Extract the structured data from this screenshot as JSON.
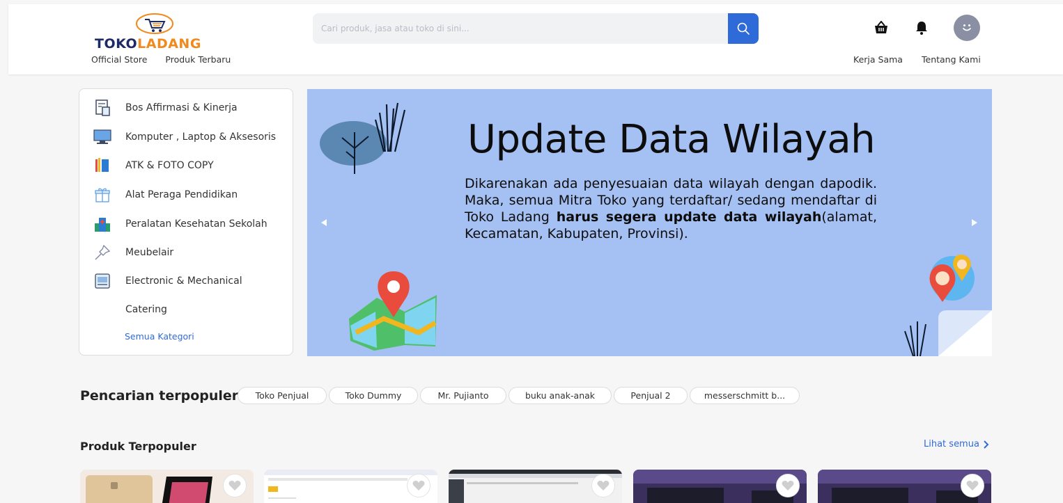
{
  "header": {
    "logo_text_1": "TOKO",
    "logo_text_2": "LADANG",
    "nav_left": [
      "Official Store",
      "Produk Terbaru"
    ],
    "search_placeholder": "Cari produk, jasa atau toko di sini...",
    "nav_right": [
      "Kerja Sama",
      "Tentang Kami"
    ]
  },
  "categories": {
    "items": [
      {
        "label": "Bos Affirmasi & Kinerja",
        "icon": "report-icon"
      },
      {
        "label": "Komputer , Laptop & Aksesoris",
        "icon": "computer-icon"
      },
      {
        "label": "ATK & FOTO COPY",
        "icon": "stationery-icon"
      },
      {
        "label": "Alat Peraga Pendidikan",
        "icon": "gift-icon"
      },
      {
        "label": "Peralatan Kesehatan Sekolah",
        "icon": "hospital-icon"
      },
      {
        "label": "Meubelair",
        "icon": "pin-icon"
      },
      {
        "label": "Electronic & Mechanical",
        "icon": "machine-icon"
      },
      {
        "label": "Catering",
        "icon": ""
      }
    ],
    "all_label": "Semua Kategori"
  },
  "banner": {
    "title": "Update Data Wilayah",
    "text_1": "Dikarenakan ada penyesuaian data wilayah dengan dapodik. Maka, semua Mitra Toko yang terdaftar/ sedang mendaftar di Toko Ladang ",
    "text_bold": "harus segera update data wilayah",
    "text_2": "(alamat, Kecamatan, Kabupaten, Provinsi)."
  },
  "popular_search": {
    "title": "Pencarian terpopuler",
    "chips": [
      "Toko Penjual",
      "Toko Dummy",
      "Mr. Pujianto",
      "buku anak-anak",
      "Penjual 2",
      "messerschmitt b..."
    ]
  },
  "popular_products": {
    "title": "Produk Terpopuler",
    "see_all": "Lihat semua"
  },
  "colors": {
    "accent": "#2f6ad9",
    "banner_bg": "#a5c0f2",
    "logo_orange": "#f08a1c",
    "logo_navy": "#1c2a66"
  }
}
